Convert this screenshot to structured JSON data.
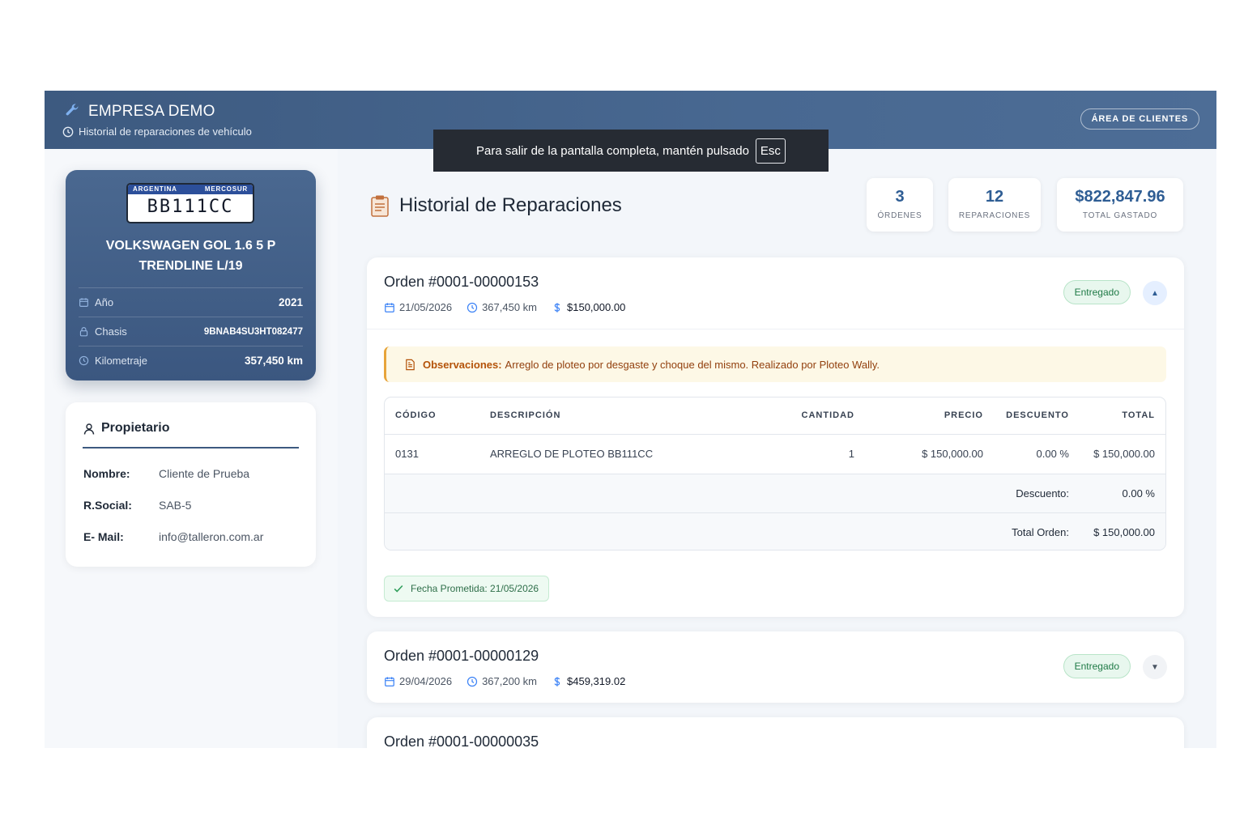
{
  "header": {
    "brand": "EMPRESA DEMO",
    "subtitle": "Historial de reparaciones de vehículo",
    "client_button": "ÁREA DE CLIENTES",
    "brand_icon": "wrench-icon",
    "subtitle_icon": "clock-icon"
  },
  "toast": {
    "text": "Para salir de la pantalla completa, mantén pulsado",
    "key": "Esc"
  },
  "vehicle": {
    "plate_country": "ARGENTINA",
    "plate_region": "MERCOSUR",
    "plate": "BB111CC",
    "model": "VOLKSWAGEN GOL 1.6 5 P TRENDLINE L/19",
    "rows": [
      {
        "label": "Año",
        "value": "2021",
        "icon": "calendar-icon"
      },
      {
        "label": "Chasis",
        "value": "9BNAB4SU3HT082477",
        "icon": "lock-icon"
      },
      {
        "label": "Kilometraje",
        "value": "357,450 km",
        "icon": "clock-icon"
      }
    ]
  },
  "owner": {
    "title": "Propietario",
    "icon": "user-icon",
    "rows": [
      {
        "key": "Nombre:",
        "value": "Cliente de Prueba"
      },
      {
        "key": "R.Social:",
        "value": "SAB-5"
      },
      {
        "key": "E- Mail:",
        "value": "info@talleron.com.ar"
      }
    ]
  },
  "main": {
    "title": "Historial de Reparaciones",
    "title_icon": "clipboard-icon",
    "stats": [
      {
        "value": "3",
        "label": "ÓRDENES"
      },
      {
        "value": "12",
        "label": "REPARACIONES"
      },
      {
        "value": "$822,847.96",
        "label": "TOTAL GASTADO"
      }
    ]
  },
  "orders": [
    {
      "title": "Orden #0001-00000153",
      "date": "21/05/2026",
      "km": "367,450 km",
      "amount": "$150,000.00",
      "status": "Entregado",
      "toggle": "▲",
      "observations_label": "Observaciones:",
      "observations": "Arreglo de ploteo por desgaste y choque del mismo. Realizado por Ploteo Wally.",
      "table": {
        "headers": [
          "CÓDIGO",
          "DESCRIPCIÓN",
          "CANTIDAD",
          "PRECIO",
          "DESCUENTO",
          "TOTAL"
        ],
        "rows": [
          [
            "0131",
            "ARREGLO DE PLOTEO BB111CC",
            "1",
            "$ 150,000.00",
            "0.00 %",
            "$ 150,000.00"
          ]
        ],
        "discount_label": "Descuento:",
        "discount_value": "0.00 %",
        "total_label": "Total Orden:",
        "total_value": "$ 150,000.00"
      },
      "promised": "Fecha Prometida: 21/05/2026"
    },
    {
      "title": "Orden #0001-00000129",
      "date": "29/04/2026",
      "km": "367,200 km",
      "amount": "$459,319.02",
      "status": "Entregado",
      "toggle": "▼"
    },
    {
      "title": "Orden #0001-00000035"
    }
  ],
  "colors": {
    "header": "#3d5a80",
    "accent": "#2e5d94",
    "success": "#1f7a46",
    "warning": "#b45309"
  }
}
